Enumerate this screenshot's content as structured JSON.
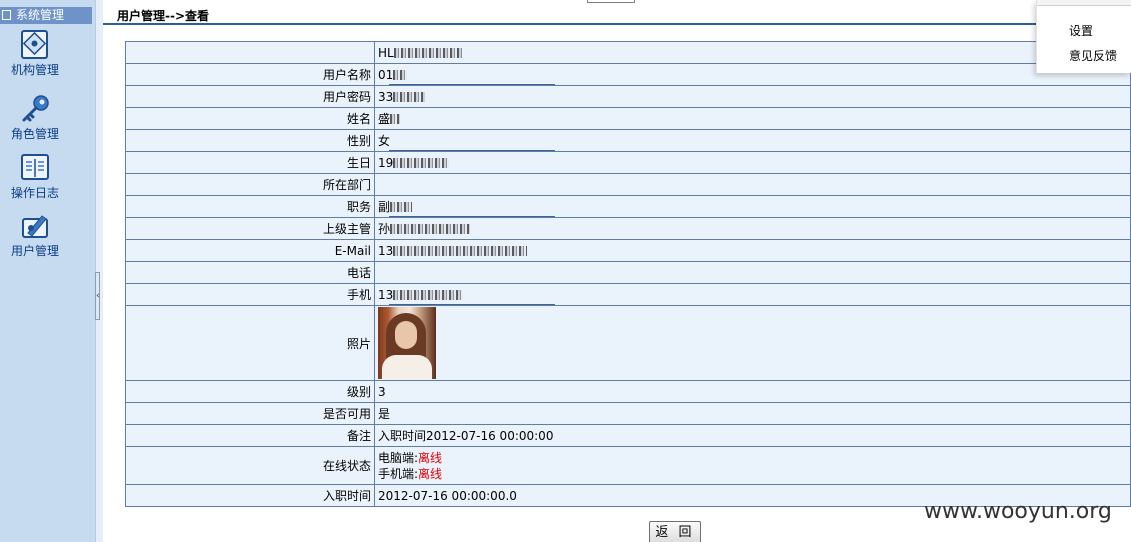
{
  "sidebar": {
    "title": "系统管理",
    "items": [
      {
        "label": "机构管理",
        "icon": "organization-icon"
      },
      {
        "label": "角色管理",
        "icon": "key-icon"
      },
      {
        "label": "操作日志",
        "icon": "book-icon"
      },
      {
        "label": "用户管理",
        "icon": "user-edit-icon"
      }
    ]
  },
  "header": {
    "title": "用户管理-->查看"
  },
  "dropdown": {
    "items": [
      {
        "label": "设置"
      },
      {
        "label": "意见反馈"
      }
    ]
  },
  "table": {
    "rows": {
      "id": {
        "label": "",
        "value": "HL"
      },
      "username": {
        "label": "用户名称",
        "value": "01"
      },
      "password": {
        "label": "用户密码",
        "value": "33"
      },
      "name": {
        "label": "姓名",
        "value": "盛"
      },
      "gender": {
        "label": "性别",
        "value": "女"
      },
      "birthday": {
        "label": "生日",
        "value": "19"
      },
      "department": {
        "label": "所在部门",
        "value": ""
      },
      "position": {
        "label": "职务",
        "value": "副"
      },
      "supervisor": {
        "label": "上级主管",
        "value": "孙"
      },
      "email": {
        "label": "E-Mail",
        "value": "13"
      },
      "phone": {
        "label": "电话",
        "value": ""
      },
      "mobile": {
        "label": "手机",
        "value": "13"
      },
      "photo": {
        "label": "照片"
      },
      "level": {
        "label": "级别",
        "value": "3"
      },
      "enabled": {
        "label": "是否可用",
        "value": "是"
      },
      "remark": {
        "label": "备注",
        "value": "入职时间2012-07-16 00:00:00"
      },
      "online_status": {
        "label": "在线状态",
        "pc_label": "电脑端:",
        "pc_value": "离线",
        "mobile_label": "手机端:",
        "mobile_value": "离线"
      },
      "hire_date": {
        "label": "入职时间",
        "value": "2012-07-16 00:00:00.0"
      }
    }
  },
  "buttons": {
    "return_label": "返 回"
  },
  "watermark": "www.wooyun.org",
  "colors": {
    "sidebar_bg": "#c7dbf0",
    "sidebar_title_bg": "#6f93c9",
    "table_bg": "#eaf3fb",
    "border": "#5f7ea6",
    "offline_text": "#e00000"
  }
}
